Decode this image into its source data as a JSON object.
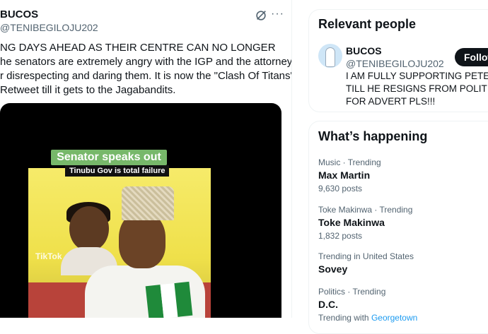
{
  "tweet": {
    "author_name": "BUCOS",
    "author_handle": "@TENIBEGILOJU202",
    "text_lines": [
      "NG DAYS AHEAD AS THEIR CENTRE CAN NO LONGER",
      "he senators are extremely angry with the IGP and the attorney",
      "r disrespecting and daring them. It is now the \"Clash Of Titans\"",
      "Retweet till it gets to the Jagabandits."
    ],
    "more_icon": "more-horizontal-icon",
    "grok_icon": "grok-icon",
    "video": {
      "banner": "Senator speaks out",
      "subbanner": "Tinubu Gov is total failure",
      "watermark": "TikTok"
    }
  },
  "relevant_people": {
    "title": "Relevant people",
    "person": {
      "name": "BUCOS",
      "handle": "@TENIBEGILOJU202",
      "follow_label": "Follow",
      "bio_lines": [
        "I AM FULLY SUPPORTING PETER OB",
        "TILL HE RESIGNS FROM POLITICS. D",
        "FOR ADVERT PLS!!!"
      ]
    }
  },
  "whats_happening": {
    "title": "What’s happening",
    "trends": [
      {
        "meta": "Music · Trending",
        "name": "Max Martin",
        "count": "9,630 posts"
      },
      {
        "meta": "Toke Makinwa · Trending",
        "name": "Toke Makinwa",
        "count": "1,832 posts"
      },
      {
        "meta": "Trending in United States",
        "name": "Sovey",
        "count": ""
      },
      {
        "meta": "Politics · Trending",
        "name": "D.C.",
        "count_prefix": "Trending with",
        "count_link": "Georgetown"
      }
    ]
  },
  "colors": {
    "accent": "#1d9bf0",
    "text": "#0f1419",
    "secondary": "#536471"
  }
}
